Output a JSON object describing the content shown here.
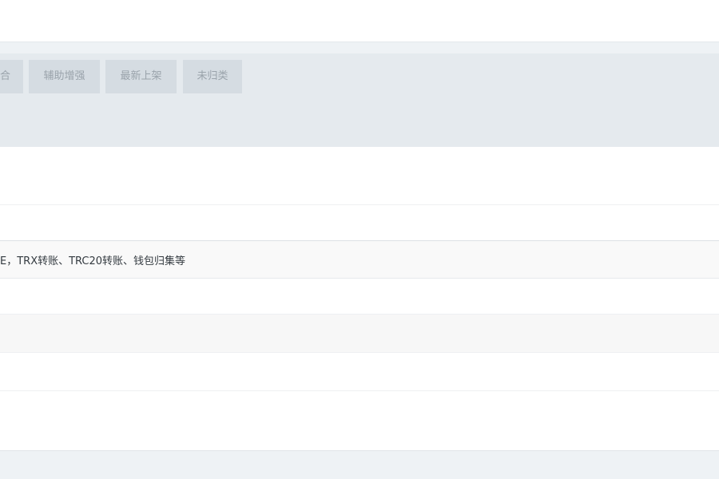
{
  "tabs": [
    {
      "label": "合"
    },
    {
      "label": "辅助增强"
    },
    {
      "label": "最新上架"
    },
    {
      "label": "未归类"
    }
  ],
  "table": {
    "description_cell": "E，TRX转账、TRC20转账、钱包归集等"
  }
}
